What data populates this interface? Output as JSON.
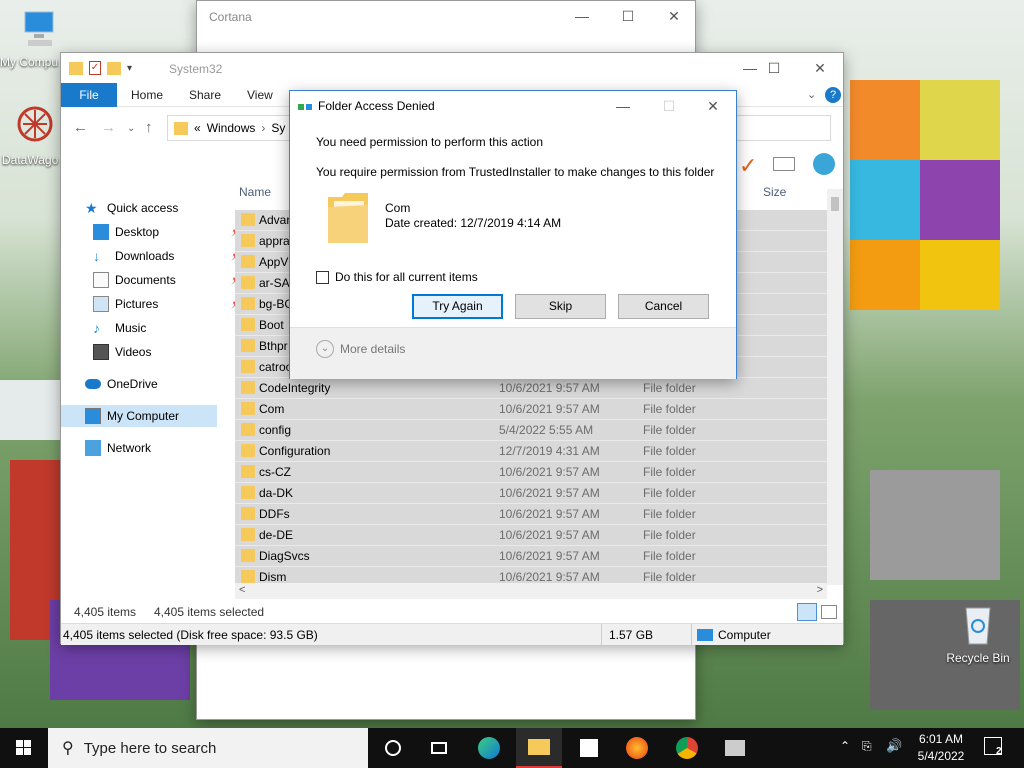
{
  "desktop": {
    "icons": [
      {
        "label": "My Compu"
      },
      {
        "label": "DataWago"
      },
      {
        "label": "Recycle Bin"
      }
    ]
  },
  "cortana": {
    "title": "Cortana"
  },
  "explorer": {
    "title": "System32",
    "ribbon_tabs": [
      "File",
      "Home",
      "Share",
      "View"
    ],
    "address": {
      "prefix": "«",
      "crumb1": "Windows",
      "crumb2": "Sy"
    },
    "columns": {
      "name": "Name",
      "size": "Size"
    },
    "nav": {
      "quick_access": "Quick access",
      "items": [
        "Desktop",
        "Downloads",
        "Documents",
        "Pictures",
        "Music",
        "Videos"
      ],
      "onedrive": "OneDrive",
      "my_computer": "My Computer",
      "network": "Network"
    },
    "rows": [
      {
        "name": "Advar",
        "date": "",
        "type": ""
      },
      {
        "name": "appra",
        "date": "",
        "type": ""
      },
      {
        "name": "AppV",
        "date": "",
        "type": ""
      },
      {
        "name": "ar-SA",
        "date": "",
        "type": ""
      },
      {
        "name": "bg-BG",
        "date": "",
        "type": ""
      },
      {
        "name": "Boot",
        "date": "",
        "type": ""
      },
      {
        "name": "Bthpr",
        "date": "",
        "type": ""
      },
      {
        "name": "catroo",
        "date": "",
        "type": ""
      },
      {
        "name": "CodeIntegrity",
        "date": "10/6/2021 9:57 AM",
        "type": "File folder"
      },
      {
        "name": "Com",
        "date": "10/6/2021 9:57 AM",
        "type": "File folder"
      },
      {
        "name": "config",
        "date": "5/4/2022 5:55 AM",
        "type": "File folder"
      },
      {
        "name": "Configuration",
        "date": "12/7/2019 4:31 AM",
        "type": "File folder"
      },
      {
        "name": "cs-CZ",
        "date": "10/6/2021 9:57 AM",
        "type": "File folder"
      },
      {
        "name": "da-DK",
        "date": "10/6/2021 9:57 AM",
        "type": "File folder"
      },
      {
        "name": "DDFs",
        "date": "10/6/2021 9:57 AM",
        "type": "File folder"
      },
      {
        "name": "de-DE",
        "date": "10/6/2021 9:57 AM",
        "type": "File folder"
      },
      {
        "name": "DiagSvcs",
        "date": "10/6/2021 9:57 AM",
        "type": "File folder"
      },
      {
        "name": "Dism",
        "date": "10/6/2021 9:57 AM",
        "type": "File folder"
      }
    ],
    "status": {
      "items": "4,405 items",
      "selected": "4,405 items selected",
      "detail": "4,405 items selected (Disk free space: 93.5 GB)",
      "size": "1.57 GB",
      "location": "Computer"
    }
  },
  "dialog": {
    "title": "Folder Access Denied",
    "heading": "You need permission to perform this action",
    "message": "You require permission from TrustedInstaller to make changes to this folder",
    "item_name": "Com",
    "item_date": "Date created: 12/7/2019 4:14 AM",
    "checkbox_label": "Do this for all current items",
    "buttons": {
      "try_again": "Try Again",
      "skip": "Skip",
      "cancel": "Cancel"
    },
    "more_details": "More details"
  },
  "taskbar": {
    "search_placeholder": "Type here to search",
    "time": "6:01 AM",
    "date": "5/4/2022",
    "notification_count": "2"
  },
  "colors": {
    "accent": "#1979ca",
    "selection": "#d9d9d9",
    "folder": "#f5c95a"
  }
}
